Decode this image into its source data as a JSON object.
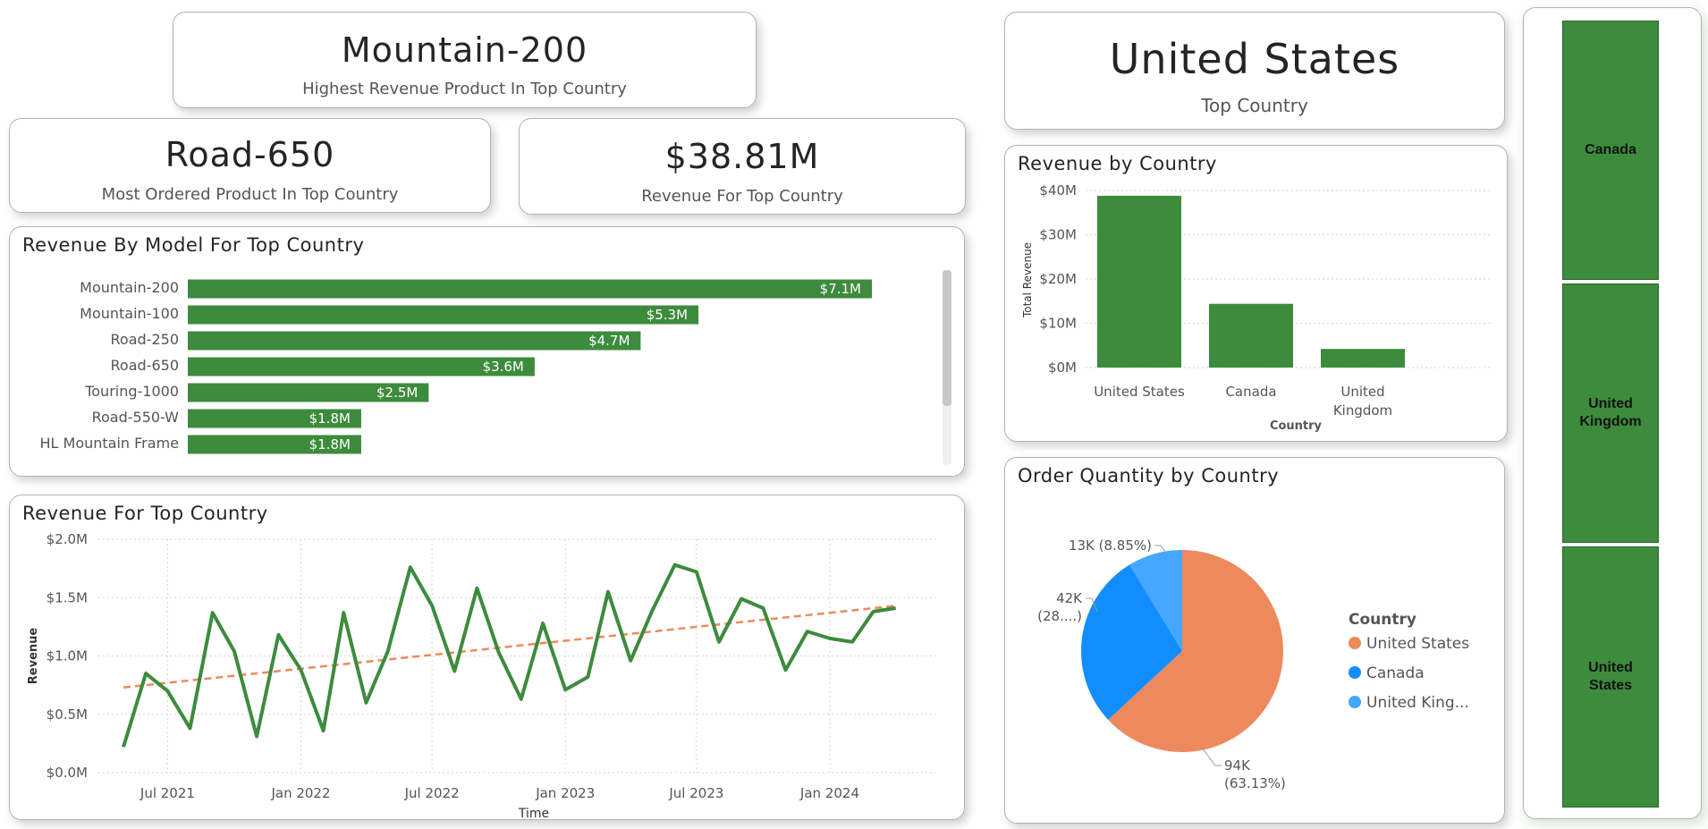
{
  "kpis": {
    "highest_product": {
      "value": "Mountain-200",
      "label": "Highest Revenue Product In Top Country"
    },
    "most_ordered": {
      "value": "Road-650",
      "label": "Most Ordered Product In Top Country"
    },
    "revenue": {
      "value": "$38.81M",
      "label": "Revenue For Top Country"
    },
    "top_country": {
      "value": "United States",
      "label": "Top Country"
    }
  },
  "bar_model": {
    "title": "Revenue By Model For Top Country",
    "color": "#3d8b3d",
    "chart_data": {
      "type": "bar",
      "orientation": "horizontal",
      "categories": [
        "Mountain-200",
        "Mountain-100",
        "Road-250",
        "Road-650",
        "Touring-1000",
        "Road-550-W",
        "HL Mountain Frame"
      ],
      "values": [
        7.1,
        5.3,
        4.7,
        3.6,
        2.5,
        1.8,
        1.8
      ],
      "data_labels": [
        "$7.1M",
        "$5.3M",
        "$4.7M",
        "$3.6M",
        "$2.5M",
        "$1.8M",
        "$1.8M"
      ],
      "unit": "$M"
    }
  },
  "line_revenue": {
    "title": "Revenue For Top Country",
    "line_color": "#3d8b3d",
    "trend_color": "#ee8a5c",
    "chart_data": {
      "type": "line",
      "xlabel": "Time",
      "ylabel": "Revenue",
      "ylim": [
        0,
        2.0
      ],
      "yticks": [
        "$0.0M",
        "$0.5M",
        "$1.0M",
        "$1.5M",
        "$2.0M"
      ],
      "xticks": [
        "Jul 2021",
        "Jan 2022",
        "Jul 2022",
        "Jan 2023",
        "Jul 2023",
        "Jan 2024"
      ],
      "grid": true,
      "x": [
        "2021-05",
        "2021-06",
        "2021-07",
        "2021-08",
        "2021-09",
        "2021-10",
        "2021-11",
        "2021-12",
        "2022-01",
        "2022-02",
        "2022-03",
        "2022-04",
        "2022-05",
        "2022-06",
        "2022-07",
        "2022-08",
        "2022-09",
        "2022-10",
        "2022-11",
        "2022-12",
        "2023-01",
        "2023-02",
        "2023-03",
        "2023-04",
        "2023-05",
        "2023-06",
        "2023-07",
        "2023-08",
        "2023-09",
        "2023-10",
        "2023-11",
        "2023-12",
        "2024-01",
        "2024-02",
        "2024-03",
        "2024-04"
      ],
      "values": [
        0.22,
        0.85,
        0.7,
        0.38,
        1.37,
        1.04,
        0.31,
        1.18,
        0.88,
        0.36,
        1.37,
        0.6,
        1.04,
        1.76,
        1.43,
        0.87,
        1.58,
        1.03,
        0.63,
        1.28,
        0.71,
        0.82,
        1.55,
        0.96,
        1.39,
        1.78,
        1.72,
        1.12,
        1.49,
        1.41,
        0.88,
        1.21,
        1.15,
        1.12,
        1.38,
        1.41
      ],
      "trend": {
        "start": 0.73,
        "end": 1.43
      }
    }
  },
  "bar_country": {
    "title": "Revenue by Country",
    "color": "#3d8b3d",
    "chart_data": {
      "type": "bar",
      "categories": [
        "United States",
        "Canada",
        "United Kingdom"
      ],
      "category_lines": [
        [
          "United States"
        ],
        [
          "Canada"
        ],
        [
          "United",
          "Kingdom"
        ]
      ],
      "values": [
        38.81,
        14.4,
        4.2
      ],
      "xlabel": "Country",
      "ylabel": "Total Revenue",
      "ylim": [
        0,
        40
      ],
      "yticks": [
        "$0M",
        "$10M",
        "$20M",
        "$30M",
        "$40M"
      ]
    }
  },
  "pie_orders": {
    "title": "Order Quantity by Country",
    "chart_data": {
      "type": "pie",
      "labels": [
        "United States",
        "Canada",
        "United Kingdom"
      ],
      "values": [
        94,
        42,
        13
      ],
      "percents": [
        63.13,
        28.02,
        8.85
      ],
      "colors": [
        "#ec8a5e",
        "#118dff",
        "#44a6ff"
      ],
      "data_labels": [
        [
          "94K",
          "(63.13%)"
        ],
        [
          "42K",
          "(28....)"
        ],
        [
          "13K (8.85%)"
        ]
      ],
      "legend_title": "Country",
      "legend_labels": [
        "United States",
        "Canada",
        "United King..."
      ],
      "legend_position": "right"
    }
  },
  "treemap": {
    "color": "#3d8b3d",
    "chart_data": {
      "type": "treemap",
      "labels": [
        "Canada",
        "United Kingdom",
        "United States"
      ],
      "label_lines": [
        [
          "Canada"
        ],
        [
          "United",
          "Kingdom"
        ],
        [
          "United",
          "States"
        ]
      ]
    }
  }
}
